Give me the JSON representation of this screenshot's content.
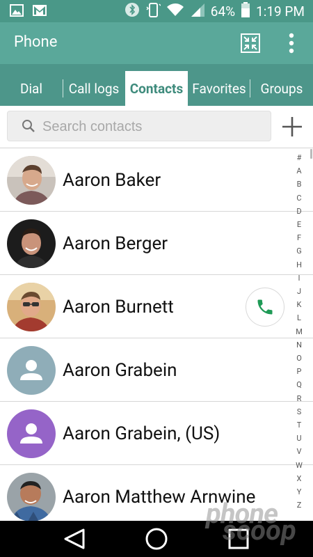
{
  "status_bar": {
    "battery_percent": "64%",
    "time": "1:19 PM",
    "icons": [
      "gallery-icon",
      "gmail-icon",
      "bluetooth-icon",
      "vibrate-icon",
      "wifi-icon",
      "signal-icon",
      "battery-icon"
    ]
  },
  "app_bar": {
    "title": "Phone"
  },
  "tabs": [
    {
      "label": "Dial",
      "active": false
    },
    {
      "label": "Call logs",
      "active": false
    },
    {
      "label": "Contacts",
      "active": true
    },
    {
      "label": "Favorites",
      "active": false
    },
    {
      "label": "Groups",
      "active": false
    }
  ],
  "search": {
    "placeholder": "Search contacts"
  },
  "contacts": [
    {
      "name": "Aaron Baker",
      "avatar": "photo"
    },
    {
      "name": "Aaron Berger",
      "avatar": "photo"
    },
    {
      "name": "Aaron Burnett",
      "avatar": "photo",
      "call_button": true
    },
    {
      "name": "Aaron Grabein",
      "avatar": "placeholder-gray"
    },
    {
      "name": "Aaron Grabein, (US)",
      "avatar": "placeholder-purple"
    },
    {
      "name": "Aaron Matthew Arnwine",
      "avatar": "photo"
    }
  ],
  "alpha_index": [
    "#",
    "A",
    "B",
    "C",
    "D",
    "E",
    "F",
    "G",
    "H",
    "I",
    "J",
    "K",
    "L",
    "M",
    "N",
    "O",
    "P",
    "Q",
    "R",
    "S",
    "T",
    "U",
    "V",
    "W",
    "X",
    "Y",
    "Z"
  ],
  "watermark": {
    "line1": "phone",
    "line2": "scoop"
  },
  "colors": {
    "status_bar": "#4a9888",
    "app_bar": "#5aa89a",
    "tab_bar": "#4d968a",
    "active_tab_text": "#3e8b7c",
    "call_green": "#1f9a56"
  }
}
